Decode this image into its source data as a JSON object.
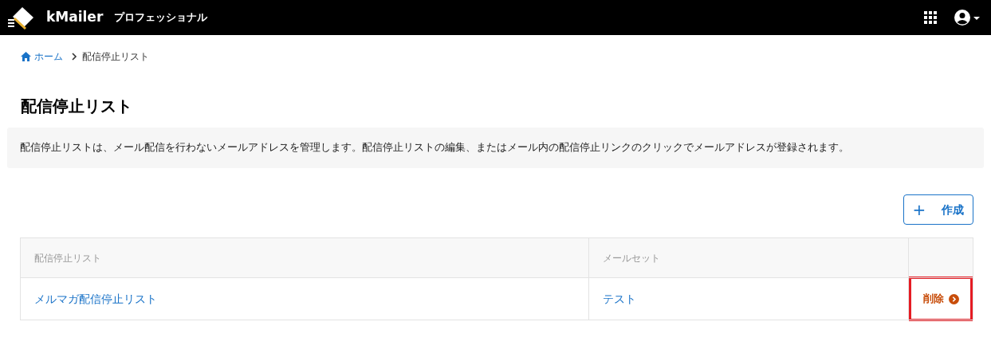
{
  "header": {
    "brand": "kMailer",
    "edition": "プロフェッショナル"
  },
  "breadcrumb": [
    {
      "label": "ホーム",
      "kind": "home"
    },
    {
      "label": "配信停止リスト",
      "kind": "current"
    }
  ],
  "title": "配信停止リスト",
  "info": "配信停止リストは、メール配信を行わないメールアドレスを管理します。配信停止リストの編集、またはメール内の配信停止リンクのクリックでメールアドレスが登録されます。",
  "create_button": {
    "icon": "+",
    "label": "作成"
  },
  "table": {
    "columns": [
      "配信停止リスト",
      "メールセット"
    ],
    "rows": [
      {
        "name": "メルマガ配信停止リスト",
        "mail_set": "テスト",
        "action": "削除",
        "highlighted": true
      }
    ]
  }
}
